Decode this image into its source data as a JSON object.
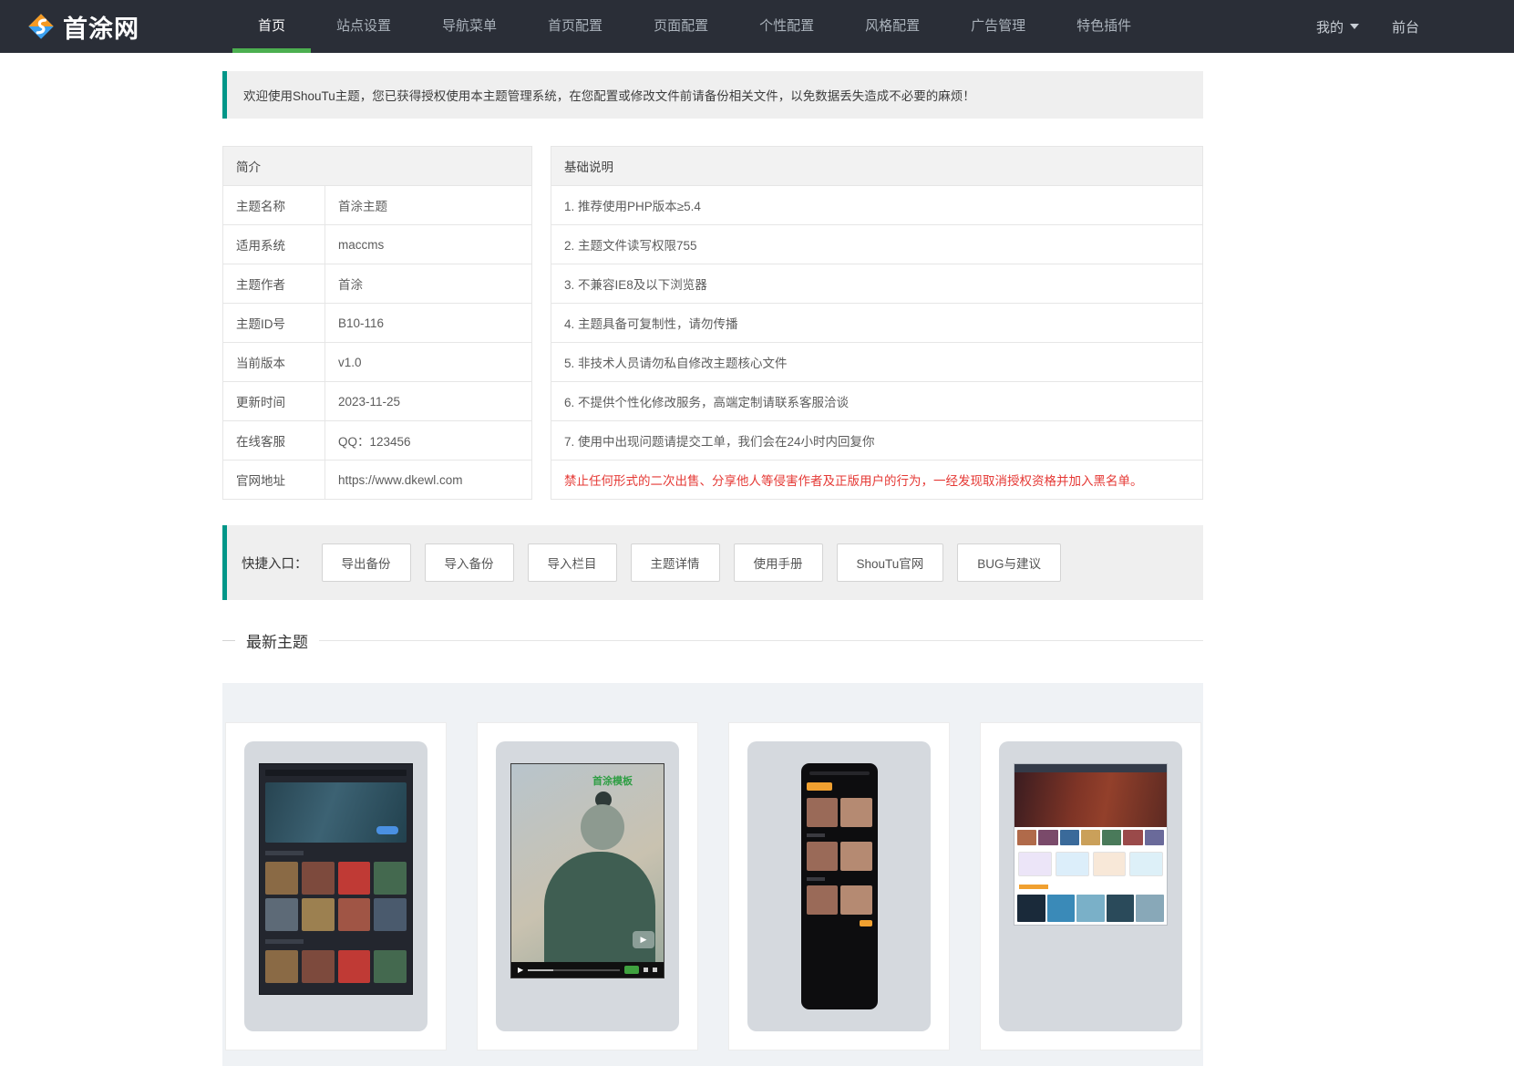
{
  "navbar": {
    "logo_text": "首涂网",
    "items": [
      "首页",
      "站点设置",
      "导航菜单",
      "首页配置",
      "页面配置",
      "个性配置",
      "风格配置",
      "广告管理",
      "特色插件"
    ],
    "right": {
      "user_menu": "我的",
      "frontend": "前台"
    }
  },
  "alert": {
    "text": "欢迎使用ShouTu主题，您已获得授权使用本主题管理系统，在您配置或修改文件前请备份相关文件，以免数据丢失造成不必要的麻烦！"
  },
  "intro_table": {
    "title": "简介",
    "rows": [
      [
        "主题名称",
        "首涂主题"
      ],
      [
        "适用系统",
        "maccms"
      ],
      [
        "主题作者",
        "首涂"
      ],
      [
        "主题ID号",
        "B10-116"
      ],
      [
        "当前版本",
        "v1.0"
      ],
      [
        "更新时间",
        "2023-11-25"
      ],
      [
        "在线客服",
        "QQ：123456"
      ],
      [
        "官网地址",
        "https://www.dkewl.com"
      ]
    ]
  },
  "notes_table": {
    "title": "基础说明",
    "rows": [
      "1. 推荐使用PHP版本≥5.4",
      "2. 主题文件读写权限755",
      "3. 不兼容IE8及以下浏览器",
      "4. 主题具备可复制性，请勿传播",
      "5. 非技术人员请勿私自修改主题核心文件",
      "6. 不提供个性化修改服务，高端定制请联系客服洽谈",
      "7. 使用中出现问题请提交工单，我们会在24小时内回复你"
    ],
    "warning": "禁止任何形式的二次出售、分享他人等侵害作者及正版用户的行为，一经发现取消授权资格并加入黑名单。"
  },
  "quick_entry": {
    "label": "快捷入口：",
    "buttons": [
      "导出备份",
      "导入备份",
      "导入栏目",
      "主题详情",
      "使用手册",
      "ShouTu官网",
      "BUG与建议"
    ]
  },
  "latest_themes": {
    "title": "最新主题",
    "video_overlay_text": "首涂模板",
    "play_glyph": "▶"
  },
  "colors": {
    "navbar_bg": "#2a2e37",
    "active_tab_underline": "#4caf50",
    "accent_teal": "#009688",
    "warning_red": "#e53935",
    "panel_bg": "#eff2f5",
    "logo_orange": "#f59a23",
    "logo_blue": "#3aa0f0"
  }
}
